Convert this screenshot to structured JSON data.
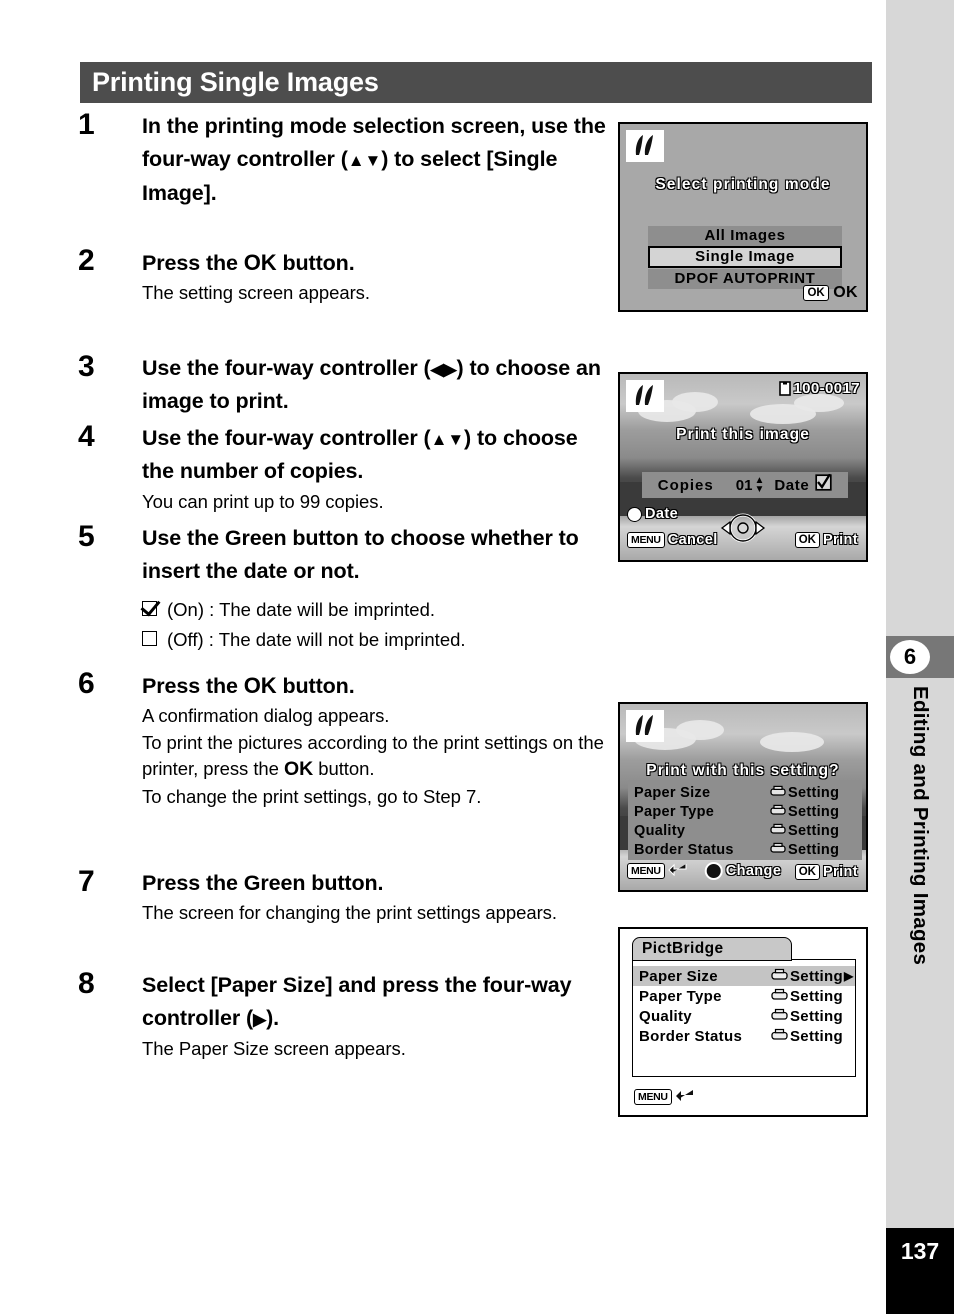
{
  "page": {
    "section_title": "Printing Single Images",
    "page_number": "137",
    "chapter_number": "6",
    "chapter_title": "Editing and Printing Images"
  },
  "steps": [
    {
      "num": "1",
      "title_a": "In the printing mode selection screen, use the four-way controller (",
      "title_arrows": "▲▼",
      "title_b": ") to select [Single Image]."
    },
    {
      "num": "2",
      "title_a": "Press the ",
      "title_ok": "OK",
      "title_b": " button.",
      "body": "The setting screen appears."
    },
    {
      "num": "3",
      "title_a": "Use the four-way controller (",
      "title_arrows": "◀▶",
      "title_b": ") to choose an image to print."
    },
    {
      "num": "4",
      "title_a": "Use the four-way controller (",
      "title_arrows": "▲▼",
      "title_b": ") to choose the number of copies.",
      "body": "You can print up to 99 copies."
    },
    {
      "num": "5",
      "title_a": "Use the Green button to choose whether to insert the date or not.",
      "check_on": "(On) : The date will be imprinted.",
      "check_off": "(Off) : The date will not be imprinted."
    },
    {
      "num": "6",
      "title_a": "Press the ",
      "title_ok": "OK",
      "title_b": " button.",
      "body_line1": "A confirmation dialog appears.",
      "body_line2a": "To print the pictures according to the print settings on the printer, press the ",
      "body_ok": "OK",
      "body_line2b": " button.",
      "body_line3": "To change the print settings, go to Step 7."
    },
    {
      "num": "7",
      "title_a": "Press the Green button.",
      "body": "The screen for changing the print settings appears."
    },
    {
      "num": "8",
      "title_a": "Select [Paper Size] and press the four-way controller (",
      "title_arrows": "▶",
      "title_b": ").",
      "body": "The Paper Size screen appears."
    }
  ],
  "screens": {
    "mode_select": {
      "title": "Select printing mode",
      "options": [
        {
          "label": "All Images",
          "selected": false
        },
        {
          "label": "Single Image",
          "selected": true
        },
        {
          "label": "DPOF AUTOPRINT",
          "selected": false
        }
      ],
      "ok_button": "OK",
      "ok_label": "OK"
    },
    "print_image": {
      "file_number": "100-0017",
      "title": "Print this image",
      "copies_label": "Copies",
      "copies_value": "01",
      "date_label": "Date",
      "date_checked": true,
      "hint_date": "Date",
      "hint_menu_button": "MENU",
      "hint_cancel": "Cancel",
      "hint_ok_button": "OK",
      "hint_print": "Print"
    },
    "confirm_settings": {
      "title": "Print with this setting?",
      "rows": [
        {
          "label": "Paper Size",
          "value": "Setting"
        },
        {
          "label": "Paper Type",
          "value": "Setting"
        },
        {
          "label": "Quality",
          "value": "Setting"
        },
        {
          "label": "Border Status",
          "value": "Setting"
        }
      ],
      "hint_menu_button": "MENU",
      "hint_change": "Change",
      "hint_ok_button": "OK",
      "hint_print": "Print"
    },
    "pictbridge_menu": {
      "tab_label": "PictBridge",
      "rows": [
        {
          "label": "Paper Size",
          "value": "Setting",
          "selected": true
        },
        {
          "label": "Paper Type",
          "value": "Setting",
          "selected": false
        },
        {
          "label": "Quality",
          "value": "Setting",
          "selected": false
        },
        {
          "label": "Border Status",
          "value": "Setting",
          "selected": false
        }
      ],
      "hint_menu_button": "MENU"
    }
  },
  "colors": {
    "header_bar": "#4d4d4d",
    "rail": "#d7d7d7",
    "badge": "#777777",
    "page_num_bg": "#000000"
  }
}
